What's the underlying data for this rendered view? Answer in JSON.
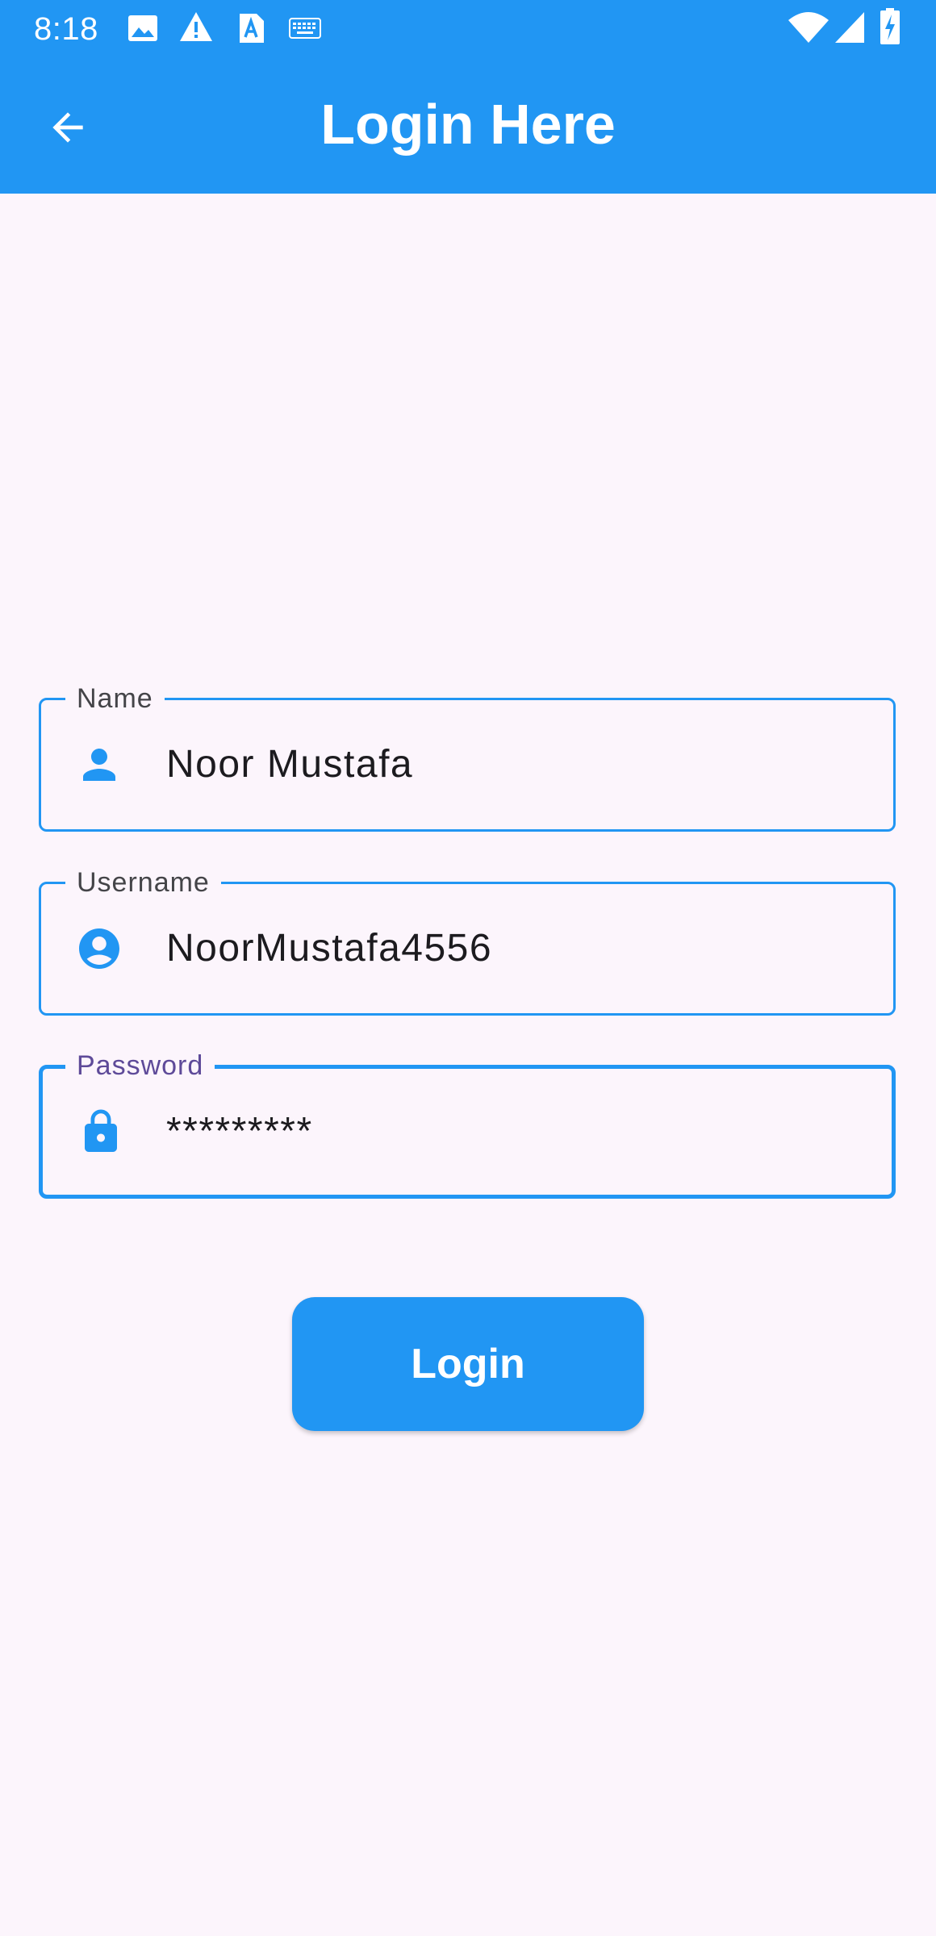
{
  "status_bar": {
    "time": "8:18",
    "left_icons": [
      "image-icon",
      "warning-icon",
      "text-a-icon",
      "keyboard-icon"
    ],
    "right_icons": [
      "wifi-icon",
      "cellular-signal-icon",
      "battery-charging-icon"
    ]
  },
  "app_bar": {
    "title": "Login Here",
    "back_icon": "arrow-back-icon",
    "background_color": "#2196F3"
  },
  "form": {
    "name": {
      "label": "Name",
      "value": "Noor Mustafa",
      "icon": "person-icon"
    },
    "username": {
      "label": "Username",
      "value": "NoorMustafa4556",
      "icon": "account-circle-icon"
    },
    "password": {
      "label": "Password",
      "value": "*********",
      "icon": "lock-icon",
      "focused": true
    }
  },
  "login_button": {
    "label": "Login"
  },
  "colors": {
    "primary": "#2196F3",
    "background": "#FCF5FC",
    "focused_label": "#5E4A99",
    "text": "#1C1B1F"
  }
}
